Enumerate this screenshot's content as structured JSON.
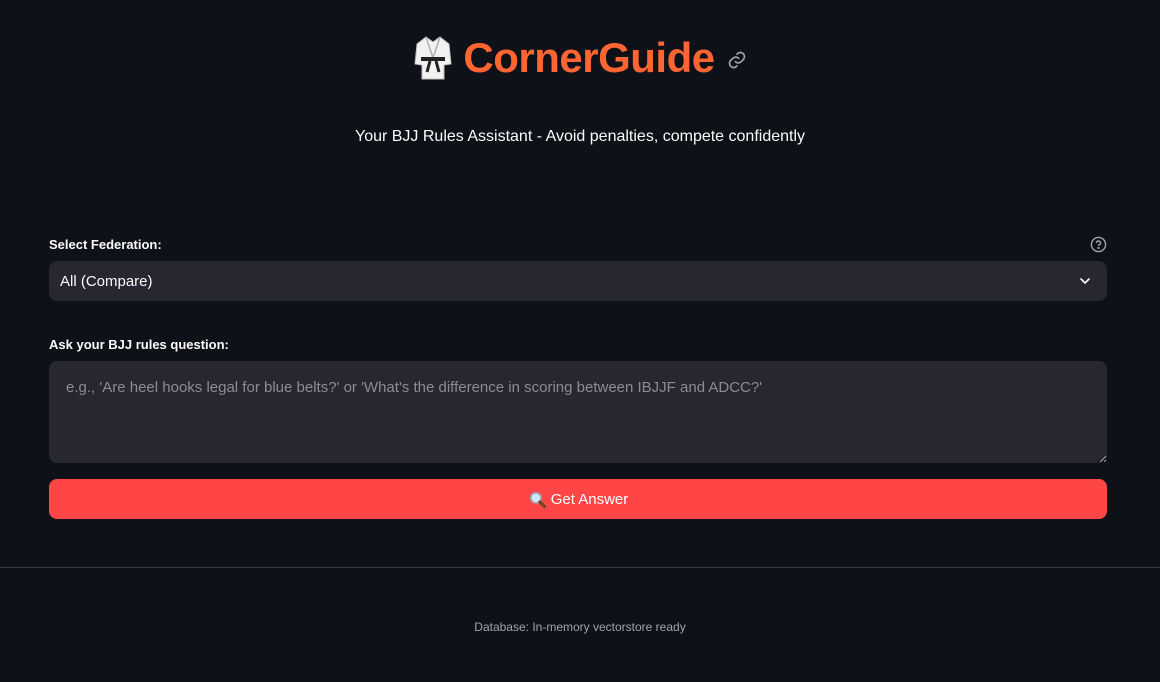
{
  "app": {
    "title": "CornerGuide",
    "subtitle": "Your BJJ Rules Assistant - Avoid penalties, compete confidently"
  },
  "federation": {
    "label": "Select Federation:",
    "selected": "All (Compare)"
  },
  "question": {
    "label": "Ask your BJJ rules question:",
    "value": "",
    "placeholder": "e.g., 'Are heel hooks legal for blue belts?' or 'What's the difference in scoring between IBJJF and ADCC?'"
  },
  "submit": {
    "label": "Get Answer",
    "icon": "magnifying-glass-icon"
  },
  "footer": {
    "status": "Database: In-memory vectorstore ready"
  },
  "colors": {
    "background": "#0e1117",
    "title": "#ff6433",
    "input_background": "#262730",
    "button": "#ff4545",
    "footer_text": "#a3a4ab"
  }
}
